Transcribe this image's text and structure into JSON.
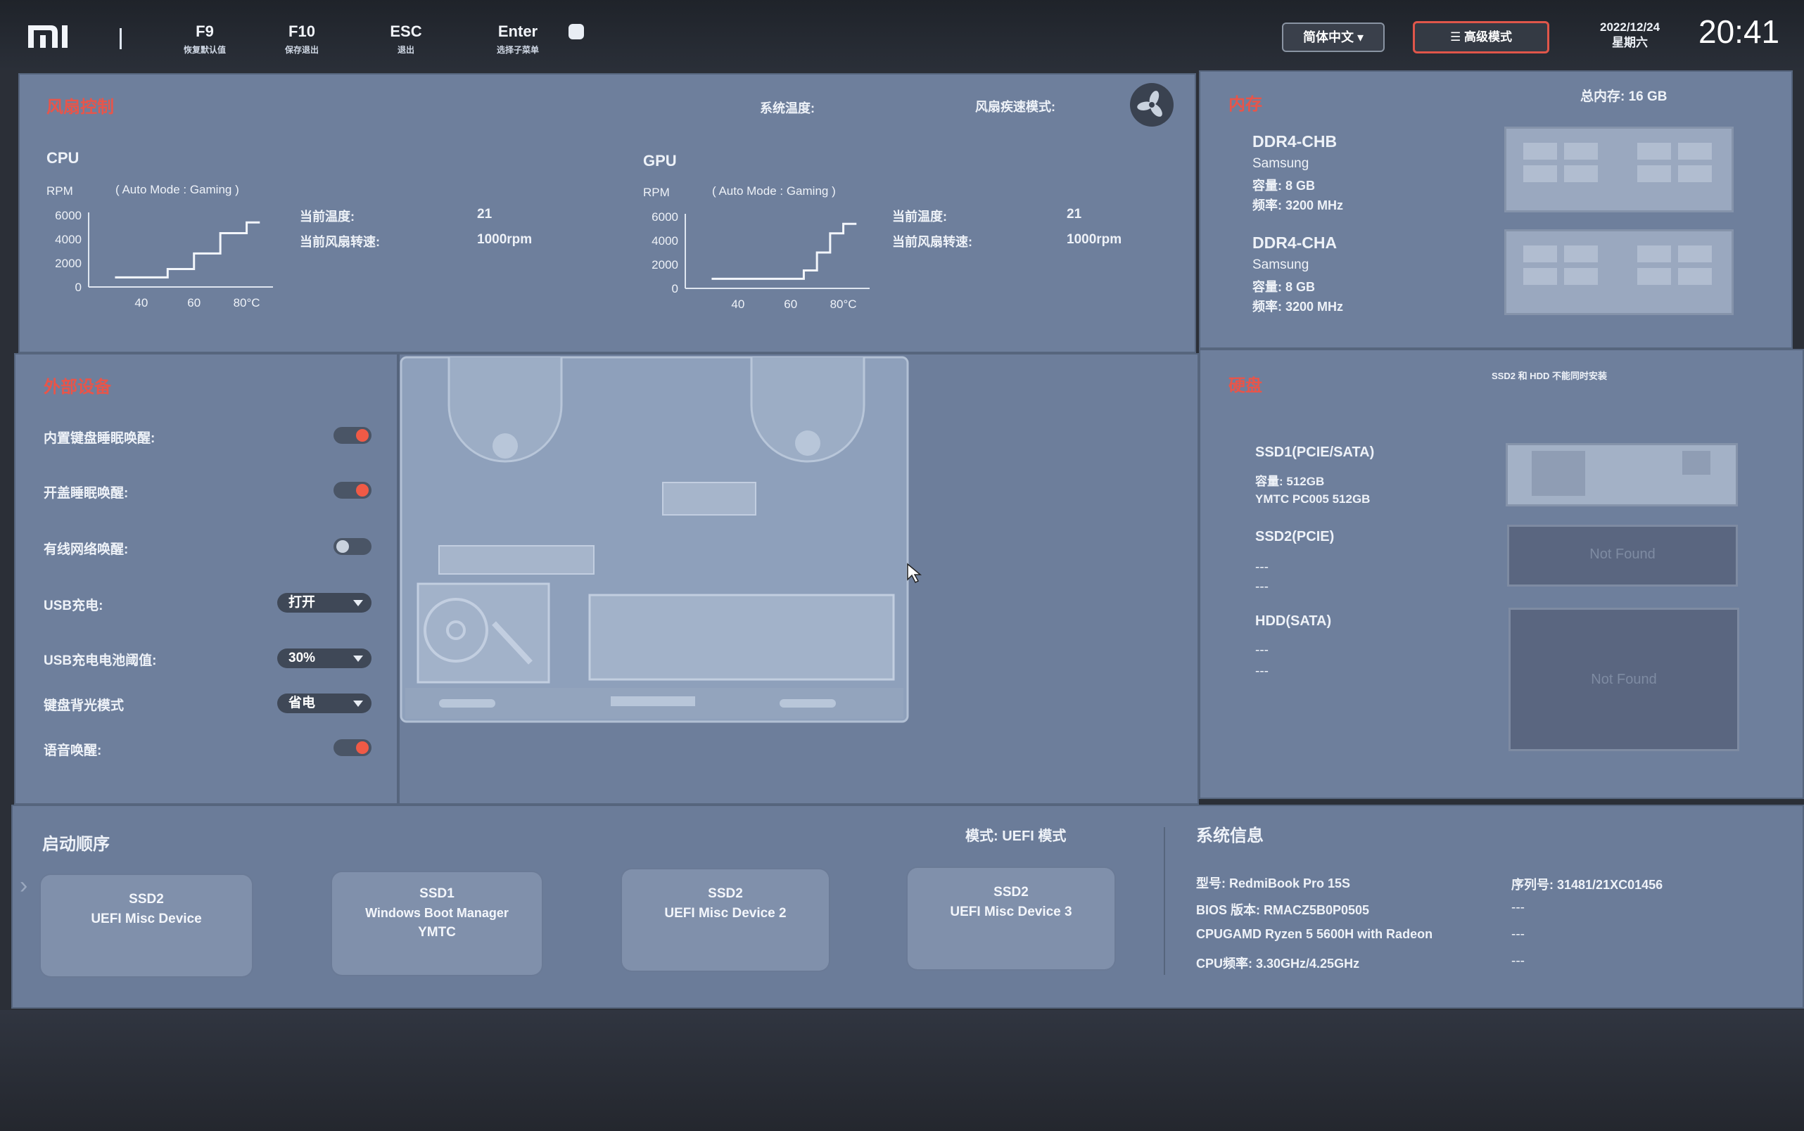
{
  "topbar": {
    "hotkeys": [
      {
        "key": "F9",
        "label": "恢复默认值"
      },
      {
        "key": "F10",
        "label": "保存退出"
      },
      {
        "key": "ESC",
        "label": "退出"
      },
      {
        "key": "Enter",
        "label": "选择子菜单"
      }
    ],
    "language": "简体中文",
    "advanced_mode": "高级模式",
    "date": "2022/12/24",
    "weekday": "星期六",
    "time": "20:41"
  },
  "fan_control": {
    "title": "风扇控制",
    "system_temp_label": "系统温度:",
    "fan_mode_label": "风扇疾速模式:",
    "cpu": {
      "name": "CPU",
      "mode": "( Auto Mode  :  Gaming )",
      "rpm_label": "RPM",
      "y_ticks": [
        "6000",
        "4000",
        "2000",
        "0"
      ],
      "x_ticks": [
        "40",
        "60",
        "80°C"
      ],
      "curve": [
        [
          30,
          800
        ],
        [
          40,
          800
        ],
        [
          50,
          1500
        ],
        [
          60,
          2800
        ],
        [
          70,
          4500
        ],
        [
          80,
          5400
        ]
      ],
      "temp_label": "当前温度:",
      "temp_value": "21",
      "speed_label": "当前风扇转速:",
      "speed_value": "1000rpm"
    },
    "gpu": {
      "name": "GPU",
      "mode": "( Auto Mode  :  Gaming )",
      "rpm_label": "RPM",
      "y_ticks": [
        "6000",
        "4000",
        "2000",
        "0"
      ],
      "x_ticks": [
        "40",
        "60",
        "80°C"
      ],
      "curve": [
        [
          30,
          800
        ],
        [
          60,
          800
        ],
        [
          65,
          1500
        ],
        [
          70,
          3000
        ],
        [
          75,
          4600
        ],
        [
          80,
          5400
        ]
      ],
      "temp_label": "当前温度:",
      "temp_value": "21",
      "speed_label": "当前风扇转速:",
      "speed_value": "1000rpm"
    }
  },
  "memory": {
    "title": "内存",
    "total": "总内存: 16 GB",
    "slots": [
      {
        "name": "DDR4-CHB",
        "vendor": "Samsung",
        "capacity": "容量: 8 GB",
        "frequency": "频率: 3200 MHz"
      },
      {
        "name": "DDR4-CHA",
        "vendor": "Samsung",
        "capacity": "容量: 8 GB",
        "frequency": "频率: 3200 MHz"
      }
    ]
  },
  "external": {
    "title": "外部设备",
    "items": [
      {
        "label": "内置键盘睡眠唤醒:",
        "type": "toggle",
        "state": "on"
      },
      {
        "label": "开盖睡眠唤醒:",
        "type": "toggle",
        "state": "on"
      },
      {
        "label": "有线网络唤醒:",
        "type": "toggle",
        "state": "off"
      },
      {
        "label": "USB充电:",
        "type": "select",
        "value": "打开"
      },
      {
        "label": "USB充电电池阈值:",
        "type": "select",
        "value": "30%"
      },
      {
        "label": "键盘背光模式",
        "type": "select",
        "value": "省电"
      },
      {
        "label": "语音唤醒:",
        "type": "toggle",
        "state": "on"
      }
    ]
  },
  "disk": {
    "title": "硬盘",
    "note": "SSD2 和 HDD 不能同时安装",
    "items": [
      {
        "name": "SSD1(PCIE/SATA)",
        "line1": "容量: 512GB",
        "line2": "YMTC PC005 512GB",
        "card": ""
      },
      {
        "name": "SSD2(PCIE)",
        "line1": "---",
        "line2": "---",
        "card": "Not Found"
      },
      {
        "name": "HDD(SATA)",
        "line1": "---",
        "line2": "---",
        "card": "Not Found"
      }
    ]
  },
  "boot": {
    "title": "启动顺序",
    "mode": "模式: UEFI 模式",
    "items": [
      {
        "line1": "SSD2",
        "line2": "UEFI Misc Device",
        "line3": ""
      },
      {
        "line1": "SSD1",
        "line2": "Windows Boot Manager",
        "line3": "YMTC"
      },
      {
        "line1": "SSD2",
        "line2": "UEFI Misc Device 2",
        "line3": ""
      },
      {
        "line1": "SSD2",
        "line2": "UEFI Misc Device 3",
        "line3": ""
      }
    ]
  },
  "sysinfo": {
    "title": "系统信息",
    "model": "型号: RedmiBook Pro 15S",
    "bios": "BIOS 版本: RMACZ5B0P0505",
    "cpu": "CPUGAMD Ryzen 5 5600H with Radeon",
    "freq": "CPU频率: 3.30GHz/4.25GHz",
    "serial": "序列号: 31481/21XC01456",
    "dash": "---"
  },
  "colors": {
    "accent": "#e8554a",
    "panel": "#6e7f9c",
    "toggle_on": "#f05a46"
  }
}
